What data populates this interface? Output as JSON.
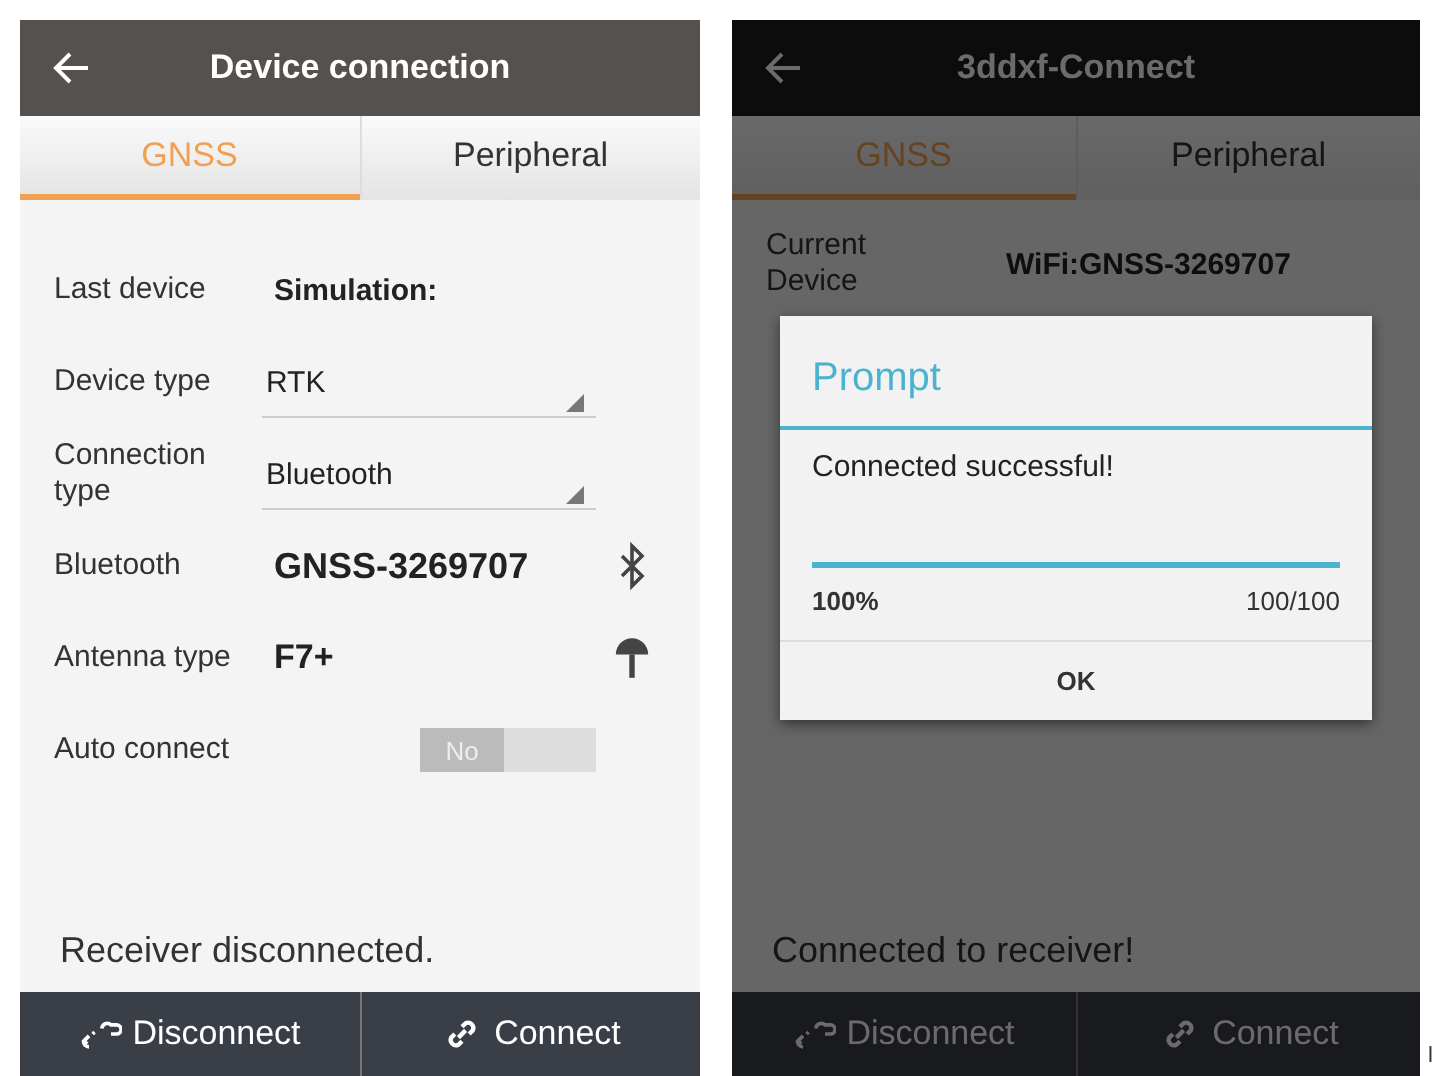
{
  "left_screen": {
    "title": "Device connection",
    "tabs": [
      {
        "label": "GNSS",
        "selected": true
      },
      {
        "label": "Peripheral",
        "selected": false
      }
    ],
    "rows": [
      {
        "kind": "plain",
        "label": "Last device",
        "value": "Simulation:"
      },
      {
        "kind": "dropdown",
        "label": "Device type",
        "value": "RTK"
      },
      {
        "kind": "dropdown",
        "label": "Connection type",
        "value": "Bluetooth"
      },
      {
        "kind": "bluetooth",
        "label": "Bluetooth",
        "value": "GNSS-3269707"
      },
      {
        "kind": "antenna",
        "label": "Antenna type",
        "value": "F7+"
      },
      {
        "kind": "toggle",
        "label": "Auto connect",
        "value": "No",
        "on": false
      }
    ],
    "status": "Receiver disconnected.",
    "buttons": [
      {
        "kind": "disconnect",
        "label": "Disconnect"
      },
      {
        "kind": "connect",
        "label": "Connect"
      }
    ]
  },
  "right_screen": {
    "title": "3ddxf-Connect",
    "tabs": [
      {
        "label": "GNSS",
        "selected": true
      },
      {
        "label": "Peripheral",
        "selected": false
      }
    ],
    "rows": [
      {
        "label": [
          "Current",
          "Device"
        ],
        "value": "WiFi:GNSS-3269707"
      }
    ],
    "status": "Connected to receiver!",
    "buttons": [
      {
        "kind": "disconnect",
        "label": "Disconnect"
      },
      {
        "kind": "connect",
        "label": "Connect"
      }
    ],
    "dialog": {
      "title": "Prompt",
      "message": "Connected successful!",
      "progress": {
        "level": 1.0,
        "percent": "100%",
        "count": "100/100"
      },
      "button": "OK"
    }
  },
  "edge_text": "l"
}
